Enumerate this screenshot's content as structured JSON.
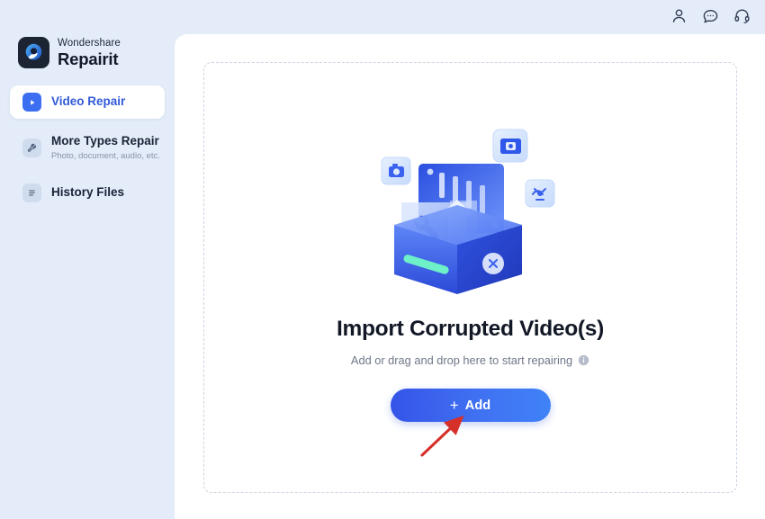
{
  "window": {
    "traffic_lights": [
      "close",
      "minimize",
      "zoom"
    ]
  },
  "header": {
    "icons": [
      {
        "name": "account-icon",
        "glyph": "person"
      },
      {
        "name": "feedback-icon",
        "glyph": "chat-bubble"
      },
      {
        "name": "support-icon",
        "glyph": "headset"
      }
    ]
  },
  "brand": {
    "name_top": "Wondershare",
    "name_bottom": "Repairit",
    "logo_name": "wondershare-repairit-logo"
  },
  "sidebar": {
    "items": [
      {
        "label": "Video Repair",
        "sub": "",
        "icon": "play-icon",
        "active": true
      },
      {
        "label": "More Types Repair",
        "sub": "Photo, document, audio, etc.",
        "icon": "wrench-icon",
        "active": false
      },
      {
        "label": "History Files",
        "sub": "",
        "icon": "list-icon",
        "active": false
      }
    ]
  },
  "main": {
    "headline": "Import Corrupted Video(s)",
    "subline": "Add or drag and drop here to start repairing",
    "add_button_label": "Add",
    "add_button_plus": "+",
    "illustration_name": "repair-toolbox-illustration",
    "info_tooltip_icon": "info-icon"
  },
  "annotation": {
    "arrow_name": "red-pointer-arrow",
    "color": "#d6302a"
  },
  "colors": {
    "sidebar_bg": "#e3ecf8",
    "panel_bg": "#ffffff",
    "accent": "#3b6ef0",
    "active_label": "#3259d8",
    "headline": "#121826",
    "subtext": "#6f7789",
    "button_gradient_from": "#3554e8",
    "button_gradient_to": "#3f82f7"
  }
}
